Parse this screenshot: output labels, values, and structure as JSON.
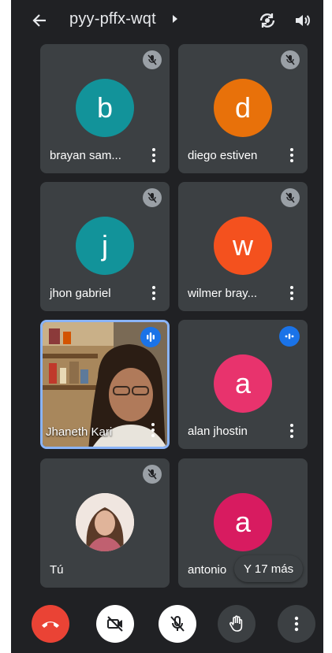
{
  "meeting": {
    "code": "pyy-pffx-wqt"
  },
  "participants": [
    {
      "initial": "b",
      "name": "brayan sam...",
      "color": "#12939a",
      "muted": true
    },
    {
      "initial": "d",
      "name": "diego estiven",
      "color": "#e8710a",
      "muted": true
    },
    {
      "initial": "j",
      "name": "jhon gabriel",
      "color": "#12939a",
      "muted": true
    },
    {
      "initial": "w",
      "name": "wilmer bray...",
      "color": "#f4511e",
      "muted": true
    },
    {
      "initial": "",
      "name": "Jhaneth Kari",
      "color": "",
      "muted": false,
      "speaking": true,
      "video": true
    },
    {
      "initial": "a",
      "name": "alan jhostin",
      "color": "#e8336d",
      "muted": false,
      "speaking": true
    },
    {
      "initial": "",
      "name": "Tú",
      "color": "",
      "muted": true,
      "photo": true
    },
    {
      "initial": "a",
      "name": "antonio",
      "color": "#d81b60",
      "muted": false
    }
  ],
  "overflow": {
    "label": "Y 17 más"
  },
  "colors": {
    "background": "#202124",
    "tile": "#3c4043",
    "end_call": "#ea4335",
    "active_border": "#8ab4f8",
    "speaking": "#1a73e8"
  },
  "icons": {
    "back": "arrow-left-icon",
    "title_caret": "caret-right-icon",
    "switch_camera": "switch-camera-icon",
    "audio_output": "speaker-icon",
    "muted": "mic-off-icon",
    "speaking": "audio-level-icon",
    "more": "more-vert-icon",
    "end_call": "call-end-icon",
    "camera_off": "videocam-off-icon",
    "mic_off": "mic-off-icon",
    "raise_hand": "hand-icon",
    "menu": "more-vert-icon"
  }
}
